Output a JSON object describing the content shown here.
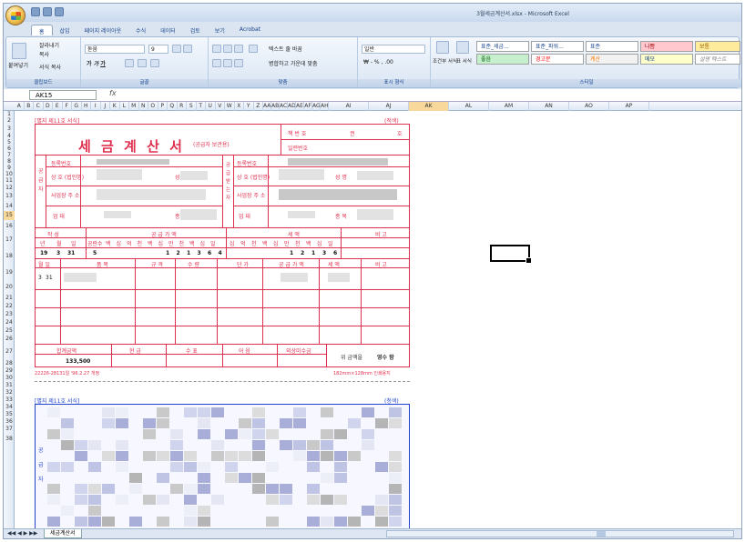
{
  "window": {
    "title": "3월세금계산서.xlsx - Microsoft Excel"
  },
  "tabs": [
    "홈",
    "삽입",
    "페이지 레이아웃",
    "수식",
    "데이터",
    "검토",
    "보기",
    "Acrobat"
  ],
  "clipboard": {
    "cut": "잘라내기",
    "copy": "복사",
    "paste": "붙여넣기",
    "format_painter": "서식 복사",
    "label": "클립보드"
  },
  "font": {
    "name": "돋움",
    "size": "9",
    "label": "글꼴"
  },
  "alignment": {
    "wrap": "텍스트 줄 바꿈",
    "merge": "병합하고 가운데 맞춤",
    "label": "맞춤"
  },
  "number": {
    "format": "일반",
    "label": "표시 형식"
  },
  "styles": {
    "conditional": "조건부 서식",
    "table": "표 서식",
    "cells": [
      "표준_세금...",
      "표준_파워...",
      "표준",
      "나쁨",
      "보통",
      "좋음",
      "경고문",
      "계산",
      "메모",
      "설명 텍스트"
    ],
    "label": "스타일"
  },
  "formula": {
    "namebox": "AK15",
    "fx": "fx",
    "value": ""
  },
  "columns": [
    "A",
    "B",
    "C",
    "D",
    "E",
    "F",
    "G",
    "H",
    "I",
    "J",
    "K",
    "L",
    "M",
    "N",
    "O",
    "P",
    "Q",
    "R",
    "S",
    "T",
    "U",
    "V",
    "W",
    "X",
    "Y",
    "Z",
    "AA",
    "AB",
    "AC",
    "AD",
    "AE",
    "AF",
    "AG",
    "AH",
    "AI",
    "AJ",
    "AK",
    "AL",
    "AM",
    "AN",
    "AO",
    "AP"
  ],
  "rows": [
    "1",
    "2",
    "3",
    "4",
    "5",
    "6",
    "7",
    "8",
    "9",
    "10",
    "11",
    "12",
    "13",
    "14",
    "15",
    "16",
    "17",
    "18",
    "19",
    "20",
    "21",
    "22",
    "23",
    "24",
    "25",
    "26",
    "27",
    "28",
    "29",
    "30",
    "31",
    "32",
    "33",
    "34",
    "35",
    "36",
    "37",
    "38"
  ],
  "invoice": {
    "form_no": "[별지 제11호 서식]",
    "copy_tag": "(적색)",
    "title": "세 금 계 산 서",
    "subtitle": "(공급자 보관용)",
    "book_no": "책 번 호",
    "volume": "권",
    "number": "호",
    "serial": "일련번호",
    "reg_no": "등록번호",
    "supplier": "공 급 자",
    "buyer": "공급받는자",
    "company": "상 호 (법인명)",
    "name": "성 명",
    "address": "사업장 주 소",
    "business": "업 태",
    "item_kind": "종 목",
    "write": "작 성",
    "supply_amount": "공 급 가 액",
    "tax": "세 액",
    "note": "비 고",
    "ymd": [
      "년",
      "월",
      "일"
    ],
    "blank": "공란수",
    "digits": [
      "백",
      "십",
      "억",
      "천",
      "백",
      "십",
      "만",
      "천",
      "백",
      "십",
      "일"
    ],
    "tax_digits": [
      "십",
      "억",
      "천",
      "백",
      "십",
      "만",
      "천",
      "백",
      "십",
      "일"
    ],
    "year": "19",
    "month": "3",
    "day": "31",
    "blank_count": "5",
    "amount_digits": [
      "1",
      "2",
      "1",
      "3",
      "6",
      "4"
    ],
    "tax_amount_digits": [
      "1",
      "2",
      "1",
      "3",
      "6"
    ],
    "items_header": [
      "월 일",
      "품 목",
      "규 격",
      "수 량",
      "단 가",
      "공 급 가 액",
      "세 액",
      "비 고"
    ],
    "item_row": {
      "month": "3",
      "day": "31"
    },
    "totals_header": [
      "합계금액",
      "현 금",
      "수 표",
      "어 음",
      "외상미수금"
    ],
    "total": "133,500",
    "receipt": "위 금액을",
    "receipt_kind": "영수 함",
    "footer_left": "22226-28131일 '96.2.27 개정",
    "footer_right": "182mm×128mm 인쇄용지"
  },
  "invoice2": {
    "form_no": "[별지 제11호 서식]",
    "copy_tag": "(청색)",
    "supplier_chars": [
      "공",
      "급",
      "자"
    ]
  },
  "sheet_tab": "세금계산서"
}
